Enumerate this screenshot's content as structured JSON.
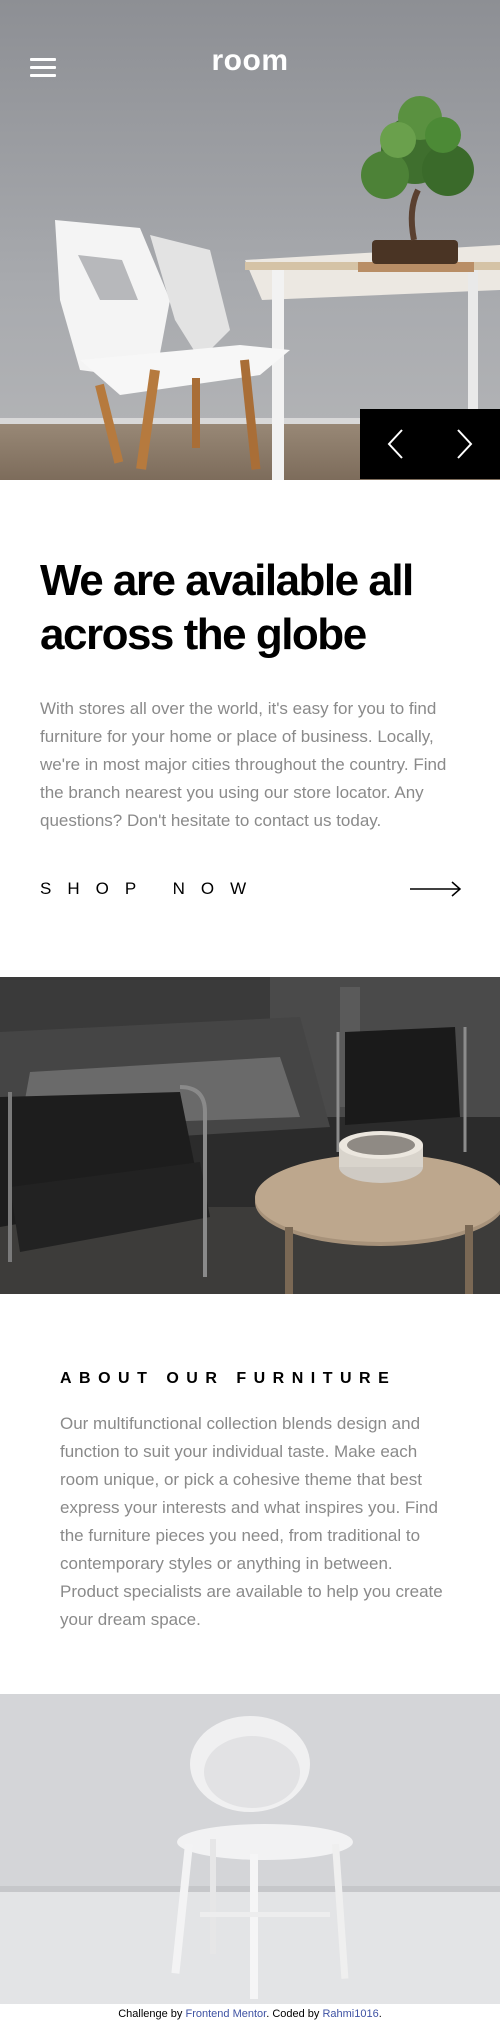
{
  "header": {
    "logo_text": "room",
    "menu_icon": "hamburger-icon"
  },
  "hero": {
    "prev_icon": "chevron-left-icon",
    "next_icon": "chevron-right-icon"
  },
  "intro": {
    "heading": "We are available all across the globe",
    "body": "With stores all over the world, it's easy for you to find furniture for your home or place of business. Locally, we're in most major cities throughout the country. Find the branch nearest you using our store locator. Any questions? Don't hesitate to contact us today.",
    "cta_label": "SHOP NOW",
    "cta_icon": "arrow-right-icon"
  },
  "about": {
    "heading": "ABOUT OUR FURNITURE",
    "body": "Our multifunctional collection blends design and function to suit your individual taste. Make each room unique, or pick a cohesive theme that best express your interests and what inspires you. Find the furniture pieces you need, from traditional to contemporary styles or anything in between. Product specialists are available to help you create your dream space."
  },
  "footer": {
    "prefix": "Challenge by ",
    "challenge_link": "Frontend Mentor",
    "middle": ". Coded by ",
    "author_link": "Rahmi1016",
    "suffix": "."
  },
  "colors": {
    "accent_text": "#000000",
    "body_text": "#8a8a8a",
    "link": "#3e52a3",
    "slider_bg": "#000000"
  }
}
